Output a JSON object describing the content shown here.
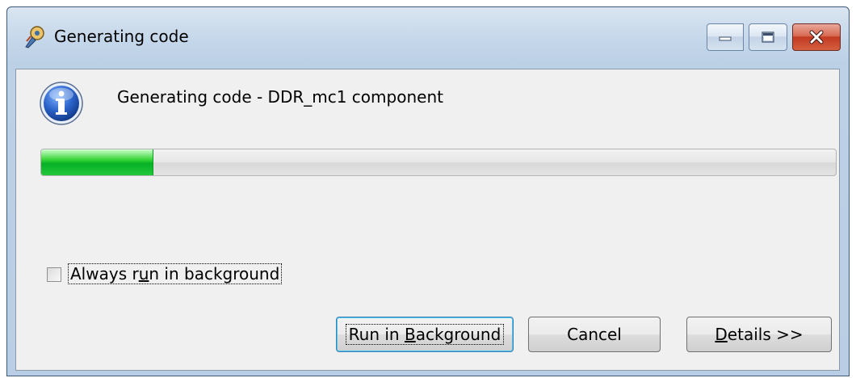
{
  "window": {
    "title": "Generating code",
    "controls": {
      "minimize": "minimize-icon",
      "maximize": "maximize-icon",
      "close": "close-icon"
    }
  },
  "dialog": {
    "icon": "info-icon",
    "message": "Generating code - DDR_mc1 component",
    "progress": {
      "fraction": 0.14,
      "color": "#06b025"
    },
    "checkbox": {
      "label_pre": "Always r",
      "label_key": "u",
      "label_post": "n in background",
      "checked": false
    },
    "buttons": {
      "run": {
        "pre": "Run in ",
        "key": "B",
        "post": "ackground"
      },
      "cancel": {
        "label": "Cancel"
      },
      "details": {
        "pre": "",
        "key": "D",
        "post": "etails >>"
      }
    }
  },
  "colors": {
    "titlebar": "#c5d7ea",
    "client": "#f0f0f0",
    "close_button": "#c23a23"
  }
}
